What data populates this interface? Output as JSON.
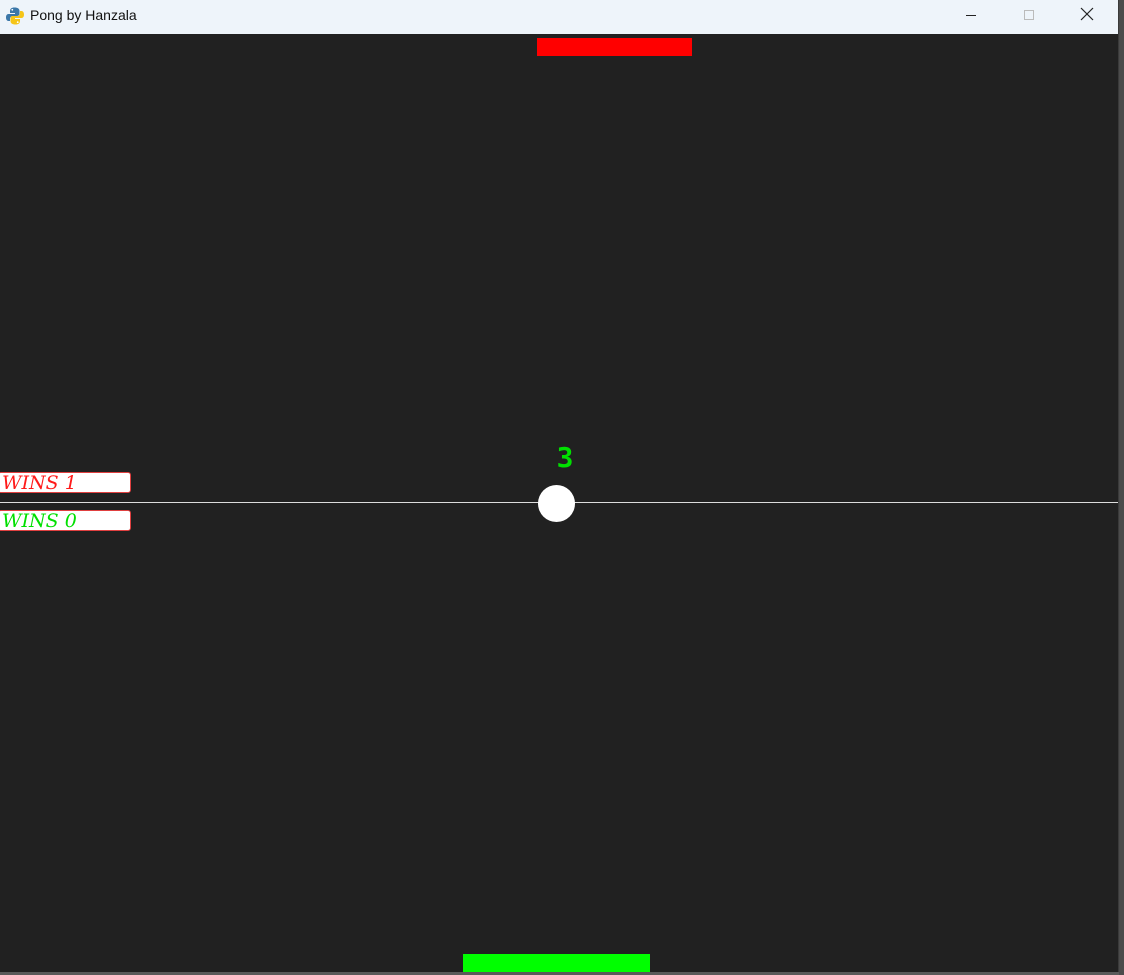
{
  "window": {
    "title": "Pong by Hanzala",
    "icon": "python-snake-icon"
  },
  "titlebar_buttons": {
    "minimize": "minimize-icon",
    "maximize": "maximize-icon",
    "close": "close-icon"
  },
  "game": {
    "countdown": "3",
    "scoreboard": {
      "red_wins": "WINS 1",
      "green_wins": "WINS 0"
    }
  },
  "colors": {
    "background": "#212121",
    "top_paddle": "#ff0000",
    "bottom_paddle": "#00ff00",
    "ball": "#ffffff",
    "countdown": "#00e000",
    "red_text": "#ff1a1a",
    "green_text": "#00e000"
  }
}
